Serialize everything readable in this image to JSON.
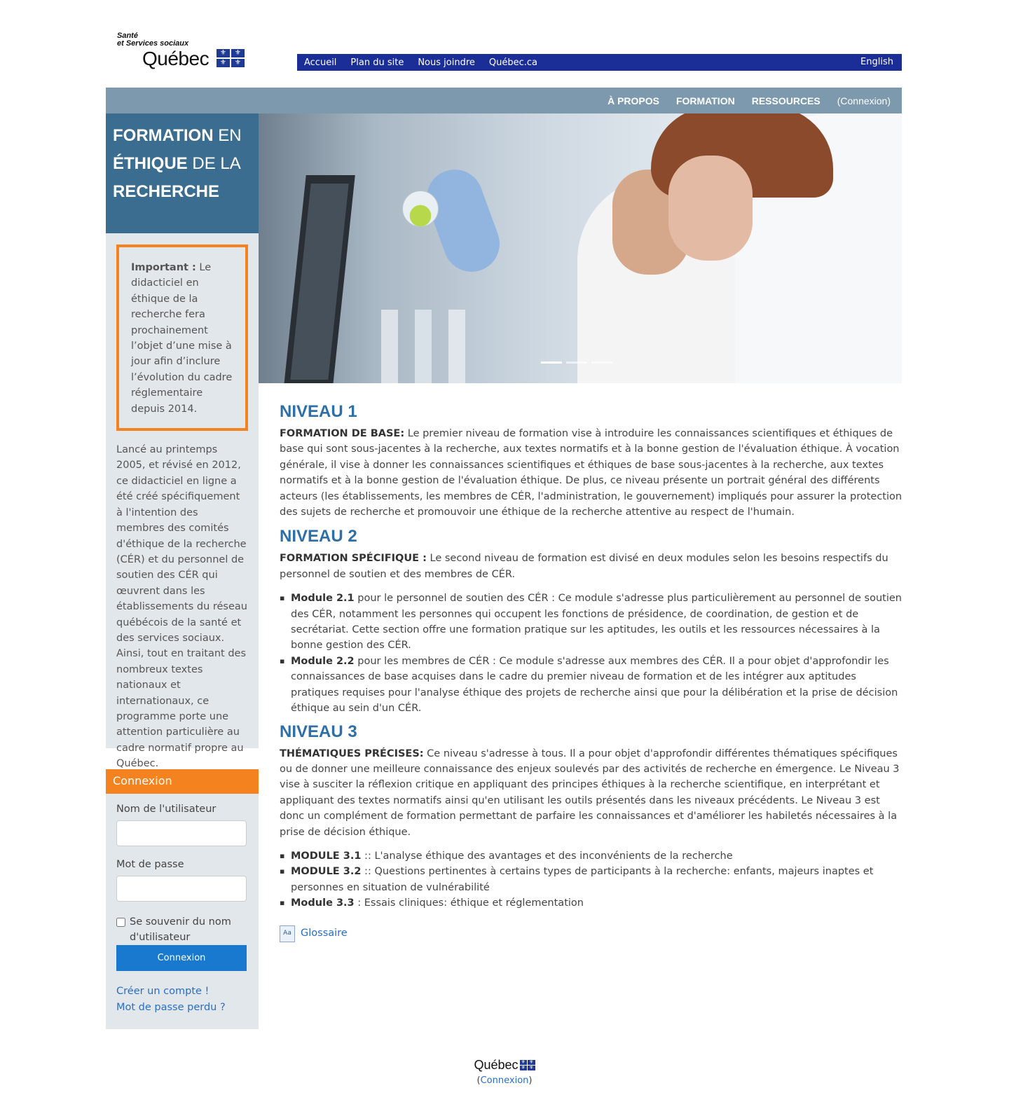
{
  "logo": {
    "line1": "Santé",
    "line2": "et Services sociaux",
    "name": "Québec",
    "flag_glyph": "⚜"
  },
  "topnav": {
    "items": [
      "Accueil",
      "Plan du site",
      "Nous joindre",
      "Québec.ca"
    ],
    "language": "English"
  },
  "mainnav": {
    "items": [
      "À PROPOS",
      "FORMATION",
      "RESSOURCES"
    ],
    "login": "(Connexion)"
  },
  "site_title": {
    "w1": "FORMATION",
    "w2": " EN",
    "w3": "ÉTHIQUE",
    "w4": " DE LA",
    "w5": "RECHERCHE"
  },
  "notice": {
    "label": "Important :",
    "text": " Le didacticiel en éthique de la recherche fera prochainement l’objet d’une mise à jour afin d’inclure l’évolution du cadre réglementaire depuis 2014."
  },
  "about": "Lancé au printemps 2005, et révisé en 2012, ce didacticiel en ligne a été créé spécifiquement à l'intention des membres des comités d'éthique de la recherche (CÉR) et du personnel de soutien des CÉR qui œuvrent dans les établissements du réseau québécois de la santé et des services sociaux. Ainsi, tout en traitant des nombreux textes nationaux et internationaux, ce programme porte une attention particulière au cadre normatif propre au Québec.",
  "login_block": {
    "title": "Connexion",
    "username_label": "Nom de l'utilisateur",
    "username_value": "",
    "password_label": "Mot de passe",
    "password_value": "",
    "remember_label": "Se souvenir du nom d'utilisateur",
    "remember_checked": false,
    "submit": "Connexion",
    "create_account": "Créer un compte !",
    "lost_password": "Mot de passe perdu ?"
  },
  "slider": {
    "slides": 3,
    "active_index": 0
  },
  "content": {
    "n1": {
      "title": "NIVEAU 1",
      "label": "FORMATION DE BASE:",
      "text": " Le premier niveau de formation vise à introduire les connaissances scientifiques et éthiques de base qui sont sous-jacentes à la recherche, aux textes normatifs et à la bonne gestion de l'évaluation éthique. À vocation générale, il vise à donner les connaissances scientifiques et éthiques de base sous-jacentes à la recherche, aux textes normatifs et à la bonne gestion de l'évaluation éthique. De plus, ce niveau présente un portrait général des différents acteurs (les établissements, les membres de CÉR, l'administration, le gouvernement) impliqués pour assurer la protection des sujets de recherche et promouvoir une éthique de la recherche attentive au respect de l'humain."
    },
    "n2": {
      "title": "NIVEAU 2",
      "label": "FORMATION SPÉCIFIQUE :",
      "text": " Le second niveau de formation est divisé en deux modules selon les besoins respectifs du personnel de soutien et des membres de CÉR.",
      "items": [
        {
          "label": "Module 2.1",
          "text": " pour le personnel de soutien des CÉR : Ce module s'adresse plus particulièrement au personnel de soutien des CÉR, notamment les personnes qui occupent les fonctions de présidence, de coordination, de gestion et de secrétariat. Cette section offre une formation pratique sur les aptitudes, les outils et les ressources nécessaires à la bonne gestion des CÉR."
        },
        {
          "label": "Module 2.2",
          "text": " pour les membres de CÉR : Ce module s'adresse aux membres des CÉR. Il a pour objet d'approfondir les connaissances de base acquises dans le cadre du premier niveau de formation et de les intégrer aux aptitudes pratiques requises pour l'analyse éthique des projets de recherche ainsi que pour la délibération et la prise de décision éthique au sein d'un CÉR."
        }
      ]
    },
    "n3": {
      "title": "NIVEAU 3",
      "label": "THÉMATIQUES PRÉCISES:",
      "text": " Ce niveau s'adresse à tous. Il a pour objet d'approfondir différentes thématiques spécifiques ou de donner une meilleure connaissance des enjeux soulevés par des activités de recherche en émergence. Le Niveau 3 vise à susciter la réflexion critique en appliquant des principes éthiques à la recherche scientifique, en interprétant et appliquant des textes normatifs ainsi qu'en utilisant les outils présentés dans les niveaux précédents. Le Niveau 3 est donc un complément de formation permettant de parfaire les connaissances et d'améliorer les habiletés nécessaires à la prise de décision éthique.",
      "items": [
        {
          "label": "MODULE 3.1",
          "text": " :: L'analyse éthique des avantages et des inconvénients de la recherche"
        },
        {
          "label": "MODULE 3.2",
          "text": " :: Questions pertinentes à certains types de participants à la recherche: enfants, majeurs inaptes et personnes en situation de vulnérabilité"
        },
        {
          "label": "Module 3.3",
          "text": " : Essais cliniques: éthique et réglementation"
        }
      ]
    },
    "glossary": {
      "icon": "Aa",
      "label": "Glossaire"
    }
  },
  "footer": {
    "name": "Québec",
    "open": "(",
    "login": "Connexion",
    "close": ")"
  }
}
